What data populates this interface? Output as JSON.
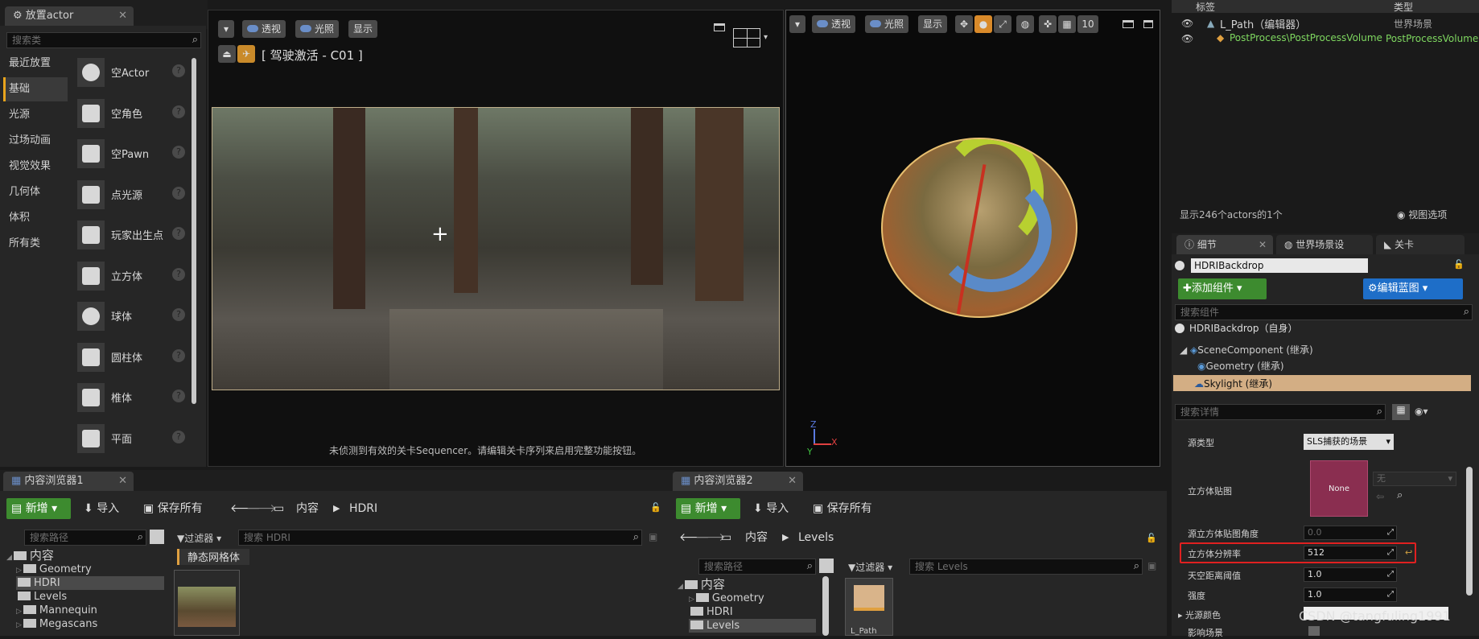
{
  "place_actor": {
    "tab": "放置actor",
    "search_placeholder": "搜索类",
    "categories": [
      "最近放置",
      "基础",
      "光源",
      "过场动画",
      "视觉效果",
      "几何体",
      "体积",
      "所有类"
    ],
    "items": [
      "空Actor",
      "空角色",
      "空Pawn",
      "点光源",
      "玩家出生点",
      "立方体",
      "球体",
      "圆柱体",
      "椎体",
      "平面"
    ]
  },
  "viewport1": {
    "perspective": "透视",
    "lit": "光照",
    "show": "显示",
    "camera_label": "[ 驾驶激活 - C01 ]",
    "message": "未侦测到有效的关卡Sequencer。请编辑关卡序列来启用完整功能按钮。"
  },
  "viewport2": {
    "perspective": "透视",
    "lit": "光照",
    "show": "显示",
    "grid_value": "10",
    "axis_z": "Z",
    "axis_x": "X",
    "axis_y": "Y"
  },
  "outliner": {
    "col_label": "标签",
    "col_type": "类型",
    "row1_name": "L_Path（编辑器）",
    "row1_type": "世界场景",
    "row2_name": "PostProcess\\PostProcessVolume",
    "row2_type": "PostProcessVolume",
    "count_text": "显示246个actors的1个",
    "view_options": "视图选项"
  },
  "details": {
    "tabs": [
      "细节",
      "世界场景设",
      "关卡"
    ],
    "actor_name": "HDRIBackdrop",
    "add_component": "添加组件",
    "edit_blueprint": "编辑蓝图",
    "search_components": "搜索组件",
    "root": "HDRIBackdrop（自身）",
    "components": [
      "SceneComponent (继承)",
      "Geometry (继承)",
      "Skylight (继承)"
    ],
    "search_details": "搜索详情",
    "props": {
      "source_type_label": "源类型",
      "source_type_value": "SLS捕获的场景",
      "cubemap_label": "立方体贴图",
      "cubemap_thumb": "None",
      "cubemap_select": "无",
      "angle_label": "源立方体贴图角度",
      "angle_value": "0.0",
      "resolution_label": "立方体分辨率",
      "resolution_value": "512",
      "sky_distance_label": "天空距离阈值",
      "sky_distance_value": "1.0",
      "intensity_label": "强度",
      "intensity_value": "1.0",
      "light_color_label": "光源颜色",
      "affects_world_label": "影响场景"
    }
  },
  "content_browser_1": {
    "tab": "内容浏览器1",
    "new": "新增",
    "import": "导入",
    "save_all": "保存所有",
    "crumb_root": "内容",
    "crumb_current": "HDRI",
    "search_path": "搜索路径",
    "filters": "过滤器",
    "search_assets": "搜索 HDRI",
    "filter_chip": "静态网格体",
    "tree": [
      "内容",
      "Geometry",
      "HDRI",
      "Levels",
      "Mannequin",
      "Megascans"
    ]
  },
  "content_browser_2": {
    "tab": "内容浏览器2",
    "new": "新增",
    "import": "导入",
    "save_all": "保存所有",
    "crumb_root": "内容",
    "crumb_current": "Levels",
    "search_path": "搜索路径",
    "filters": "过滤器",
    "search_assets": "搜索 Levels",
    "tree": [
      "内容",
      "Geometry",
      "HDRI",
      "Levels"
    ],
    "asset_label": "L_Path"
  },
  "watermark": "CSDN @tangfuling1991",
  "colors": {
    "accent": "#e8a41d",
    "green": "#3d8b2f",
    "blue": "#1e6ec8",
    "highlight": "#e02020"
  }
}
